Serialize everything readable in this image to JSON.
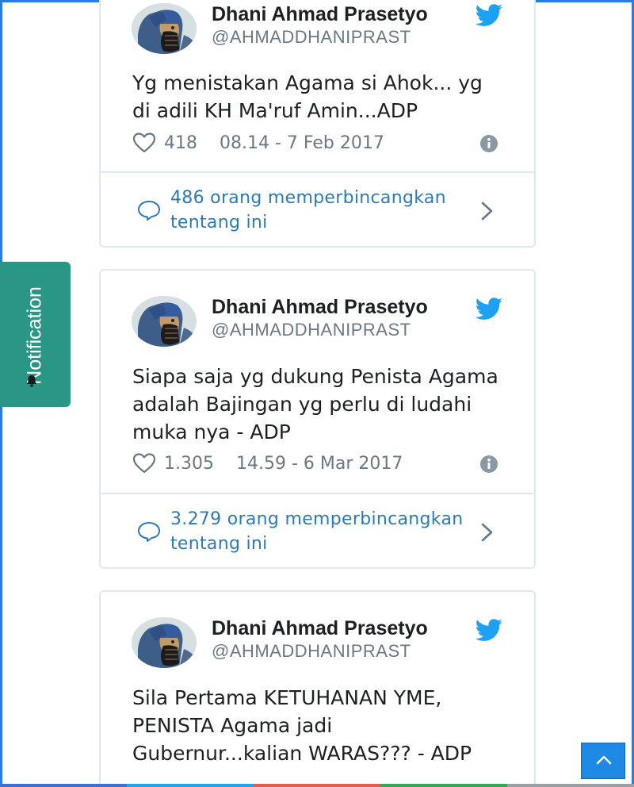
{
  "author": {
    "name": "Dhani Ahmad Prasetyo",
    "handle": "@AHMADDHANIPRAST"
  },
  "tweets": [
    {
      "text": "Yg menistakan Agama si Ahok... yg di adili KH Ma'ruf Amin...ADP",
      "likes": "418",
      "timestamp": "08.14 - 7 Feb 2017",
      "discussion": "486 orang memperbincangkan tentang ini"
    },
    {
      "text": "Siapa saja yg dukung Penista Agama adalah Bajingan yg perlu di ludahi muka nya - ADP",
      "likes": "1.305",
      "timestamp": "14.59 - 6 Mar 2017",
      "discussion": "3.279 orang memperbincangkan tentang ini"
    },
    {
      "text": "Sila Pertama KETUHANAN YME, PENISTA Agama jadi Gubernur...kalian WARAS??? - ADP"
    }
  ],
  "notification": {
    "label": "Notification",
    "icon": "bell-icon"
  },
  "scroll_top": {
    "icon": "chevron-up-icon"
  },
  "colors": {
    "twitter_blue": "#1da1f2",
    "link_blue": "#2b7bb9",
    "notification_teal": "#2a9786",
    "scroll_button_blue": "#1e88e5",
    "border_gray": "#e1e8ed",
    "meta_gray": "#697882"
  },
  "icons": [
    "avatar",
    "twitter-bird-icon",
    "heart-icon",
    "info-icon",
    "speech-bubble-icon",
    "chevron-right-icon"
  ]
}
